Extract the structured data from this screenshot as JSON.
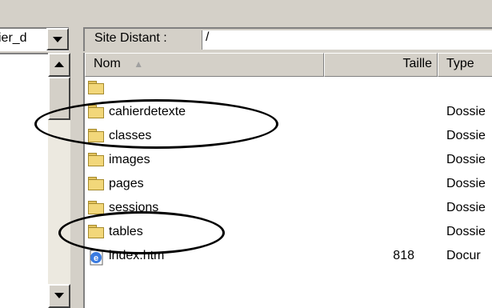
{
  "left": {
    "combo_value": "ier_d"
  },
  "remote": {
    "label": "Site Distant :",
    "path": "/"
  },
  "columns": [
    {
      "label": "Nom"
    },
    {
      "label": "Taille"
    },
    {
      "label": "Type"
    }
  ],
  "sort_indicator": "▲",
  "rows": [
    {
      "name": "",
      "size": "",
      "type": "",
      "icon": "folder-icon"
    },
    {
      "name": "cahierdetexte",
      "size": "",
      "type": "Dossie",
      "icon": "folder-icon"
    },
    {
      "name": "classes",
      "size": "",
      "type": "Dossie",
      "icon": "folder-icon"
    },
    {
      "name": "images",
      "size": "",
      "type": "Dossie",
      "icon": "folder-icon"
    },
    {
      "name": "pages",
      "size": "",
      "type": "Dossie",
      "icon": "folder-icon"
    },
    {
      "name": "sessions",
      "size": "",
      "type": "Dossie",
      "icon": "folder-icon"
    },
    {
      "name": "tables",
      "size": "",
      "type": "Dossie",
      "icon": "folder-icon"
    },
    {
      "name": "index.htm",
      "size": "818",
      "type": "Docur",
      "icon": "ie-document-icon"
    }
  ],
  "colors": {
    "chrome": "#d4d0c8",
    "folder": "#f2d77a",
    "annotation": "#000000"
  }
}
